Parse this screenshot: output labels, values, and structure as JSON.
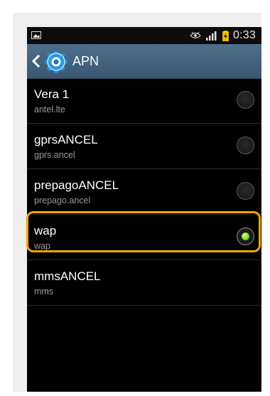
{
  "status_bar": {
    "time": "0:33",
    "icons": [
      "image-notification-icon",
      "eye-icon",
      "signal-icon",
      "battery-charging-icon"
    ]
  },
  "action_bar": {
    "title": "APN",
    "back_icon": "chevron-left-icon",
    "app_icon": "settings-gear-icon"
  },
  "apn_list": [
    {
      "name": "Vera 1",
      "apn": "antel.lte",
      "selected": false
    },
    {
      "name": "gprsANCEL",
      "apn": "gprs.ancel",
      "selected": false
    },
    {
      "name": "prepagoANCEL",
      "apn": "prepago.ancel",
      "selected": false
    },
    {
      "name": "wap",
      "apn": "wap",
      "selected": true
    },
    {
      "name": "mmsANCEL",
      "apn": "mms",
      "selected": null
    }
  ],
  "colors": {
    "action_bar": "#45647f",
    "highlight": "#f0a500",
    "radio_selected": "#7ed321"
  }
}
